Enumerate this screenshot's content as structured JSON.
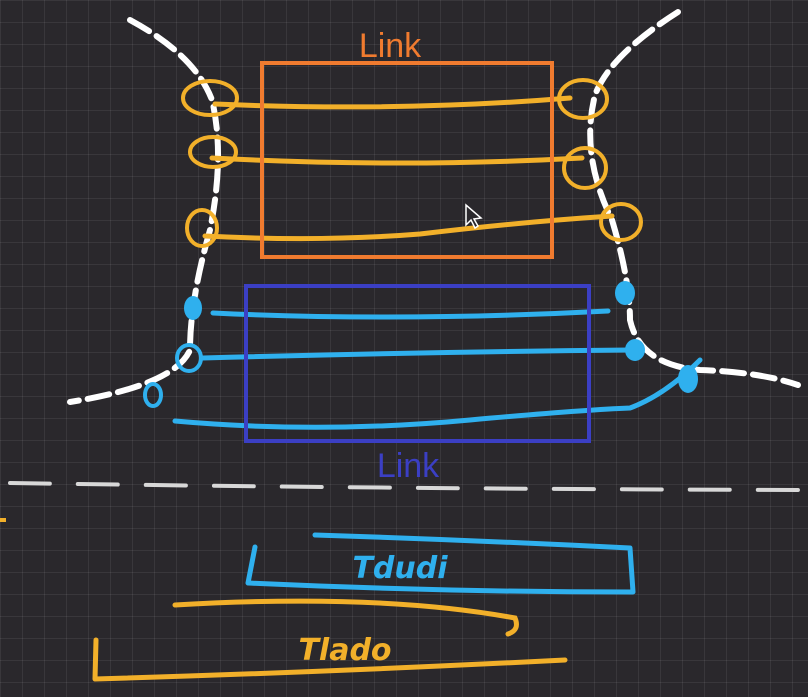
{
  "labels": {
    "top_box": "Link",
    "bottom_box": "Link",
    "blue_bar_text": "Tdudi",
    "orange_bar_text": "Tlado"
  },
  "colors": {
    "background": "#2a282c",
    "orange_box": "#f07b2f",
    "blue_box": "#3b3fc4",
    "orange_ink": "#f2b02a",
    "blue_ink": "#2fb0ee",
    "white_ink": "#ffffff",
    "dash": "#d8d8d8"
  }
}
